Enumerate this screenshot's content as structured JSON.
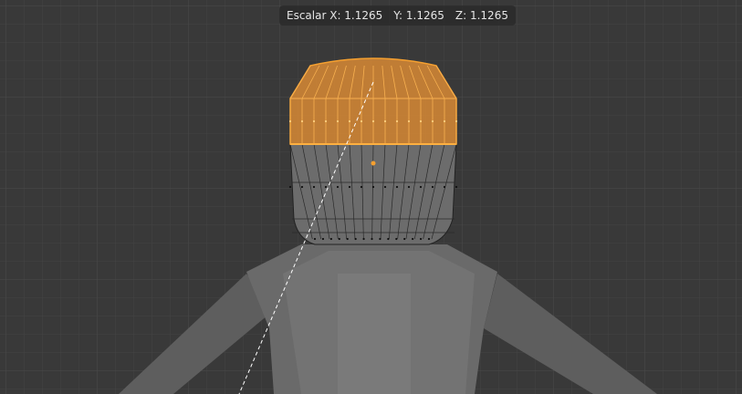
{
  "header": {
    "scale_x": "Escalar X: 1.1265",
    "scale_y": "Y: 1.1265",
    "scale_z": "Z: 1.1265"
  },
  "colors": {
    "background": "#3a3a3a",
    "selection": "#f5a030",
    "mesh": "#6e6e6e"
  }
}
